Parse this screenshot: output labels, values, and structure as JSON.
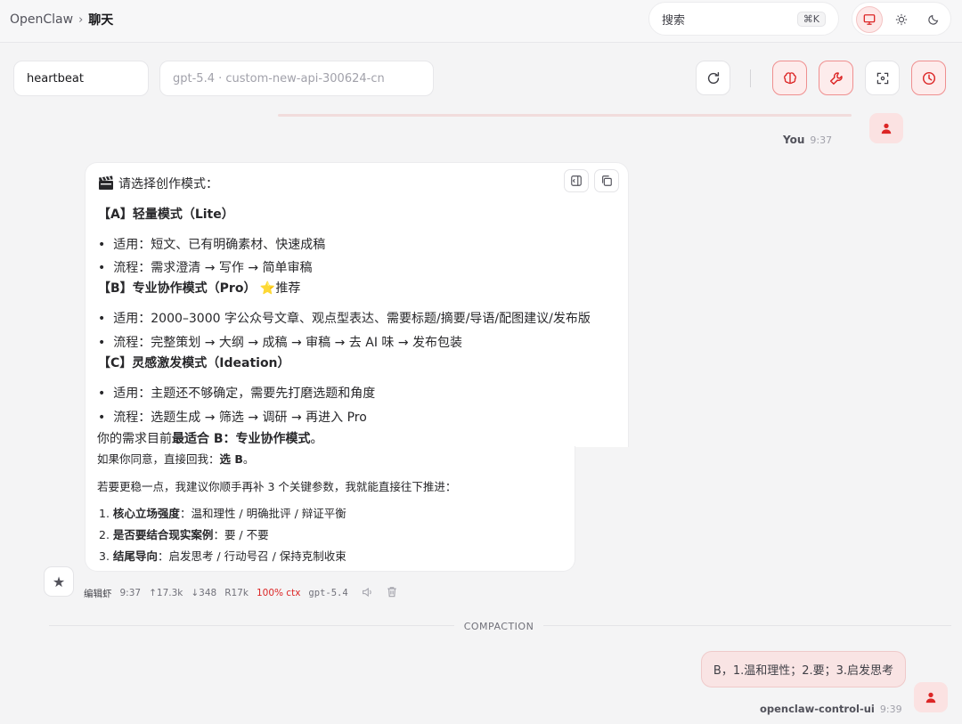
{
  "header": {
    "breadcrumb_root": "OpenClaw",
    "breadcrumb_sep": "›",
    "breadcrumb_current": "聊天",
    "search_placeholder": "搜索",
    "search_shortcut": "⌘K"
  },
  "toolbar": {
    "session": "heartbeat",
    "model": "gpt-5.4 · custom-new-api-300624-cn"
  },
  "prev_message": {
    "sender": "You",
    "time": "9:37"
  },
  "assistant_message": {
    "intro": "请选择创作模式：",
    "mode_a_title": "【A】轻量模式（Lite）",
    "mode_a_use": "适用：短文、已有明确素材、快速成稿",
    "mode_a_flow": "流程：需求澄清 → 写作 → 简单审稿",
    "mode_b_title": "【B】专业协作模式（Pro）",
    "mode_b_star": "⭐",
    "mode_b_recommend": "推荐",
    "mode_b_use": "适用：2000–3000 字公众号文章、观点型表达、需要标题/摘要/导语/配图建议/发布版",
    "mode_b_flow": "流程：完整策划 → 大纲 → 成稿 → 审稿 → 去 AI 味 → 发布包装",
    "mode_c_title": "【C】灵感激发模式（Ideation）",
    "mode_c_use": "适用：主题还不够确定，需要先打磨选题和角度",
    "mode_c_flow": "流程：选题生成 → 筛选 → 调研 → 再进入 Pro",
    "best_prefix": "你的需求目前",
    "best_bold": "最适合 B：专业协作模式",
    "best_suffix": "。",
    "agree_prefix": "如果你同意，直接回我：",
    "agree_bold": "选 B",
    "agree_suffix": "。",
    "params_intro": "若要更稳一点，我建议你顺手再补 3 个关键参数，我就能直接往下推进：",
    "param1_num": "1.",
    "param1_label": "核心立场强度",
    "param1_value": "：温和理性 / 明确批评 / 辩证平衡",
    "param2_num": "2.",
    "param2_label": "是否要结合现实案例",
    "param2_value": "：要 / 不要",
    "param3_num": "3.",
    "param3_label": "结尾导向",
    "param3_value": "：启发思考 / 行动号召 / 保持克制收束"
  },
  "assistant_meta": {
    "name": "编辑虾",
    "time": "9:37",
    "tokens_in": "↑17.3k",
    "tokens_out": "↓348",
    "cache": "R17k",
    "ctx": "100% ctx",
    "model": "gpt-5.4"
  },
  "divider_label": "COMPACTION",
  "user_message": {
    "text": "B，1.温和理性；2.要；3.启发思考",
    "sender": "openclaw-control-ui",
    "time": "9:39"
  },
  "colors": {
    "accent": "#dc2626",
    "accent_soft": "#fde8e8"
  }
}
